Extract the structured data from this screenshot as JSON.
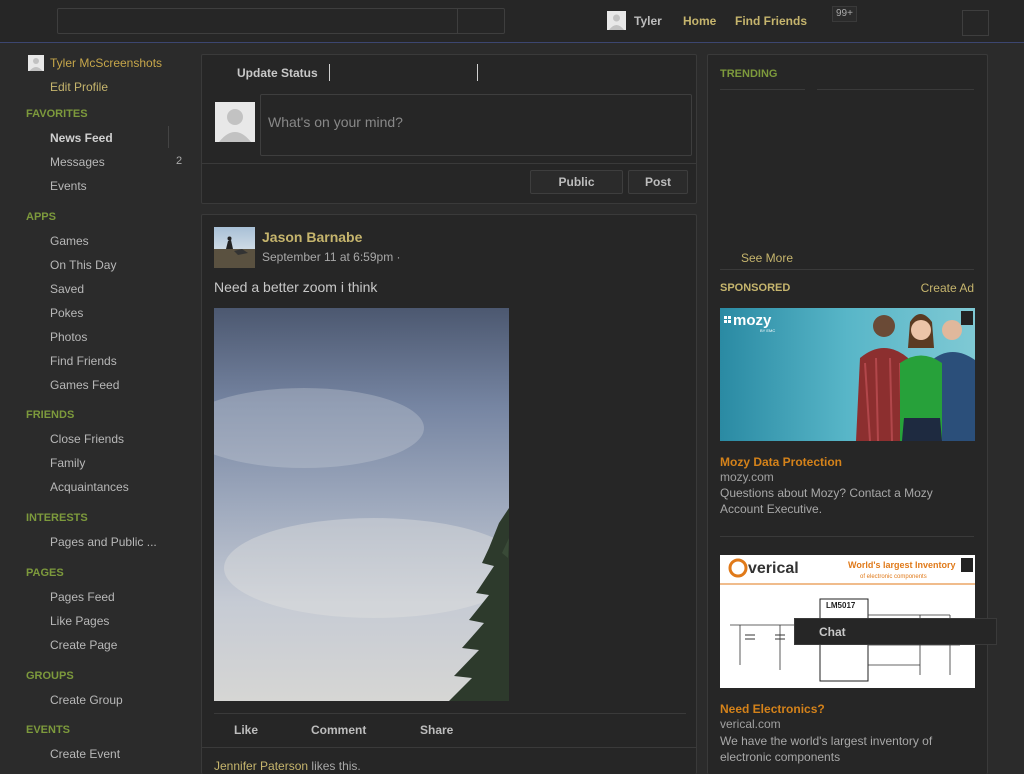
{
  "topbar": {
    "user_name": "Tyler",
    "home": "Home",
    "find_friends": "Find Friends",
    "notif_badge": "99+"
  },
  "sidebar": {
    "profile_name": "Tyler McScreenshots",
    "edit_profile": "Edit Profile",
    "favorites": {
      "heading": "FAVORITES",
      "items": [
        "News Feed",
        "Messages",
        "Events"
      ],
      "messages_count": "2"
    },
    "apps": {
      "heading": "APPS",
      "items": [
        "Games",
        "On This Day",
        "Saved",
        "Pokes",
        "Photos",
        "Find Friends",
        "Games Feed"
      ]
    },
    "friends": {
      "heading": "FRIENDS",
      "items": [
        "Close Friends",
        "Family",
        "Acquaintances"
      ]
    },
    "interests": {
      "heading": "INTERESTS",
      "items": [
        "Pages and Public ..."
      ]
    },
    "pages": {
      "heading": "PAGES",
      "items": [
        "Pages Feed",
        "Like Pages",
        "Create Page"
      ]
    },
    "groups": {
      "heading": "GROUPS",
      "items": [
        "Create Group"
      ]
    },
    "events": {
      "heading": "EVENTS",
      "items": [
        "Create Event"
      ]
    }
  },
  "composer": {
    "tab": "Update Status",
    "placeholder": "What's on your mind?",
    "audience": "Public",
    "post": "Post"
  },
  "post": {
    "author": "Jason Barnabe",
    "time": "September 11 at 6:59pm ·",
    "text": "Need a better zoom i think",
    "actions": {
      "like": "Like",
      "comment": "Comment",
      "share": "Share"
    },
    "likes_name": "Jennifer Paterson",
    "likes_suffix": " likes this."
  },
  "right": {
    "trending": "TRENDING",
    "see_more": "See More",
    "sponsored": "SPONSORED",
    "create_ad": "Create Ad",
    "ads": [
      {
        "brand": "mozy",
        "brand_sub": "BY EMC",
        "title": "Mozy Data Protection",
        "domain": "mozy.com",
        "desc": "Questions about Mozy? Contact a Mozy Account Executive."
      },
      {
        "brand": "verical",
        "tagline1": "World's largest Inventory",
        "tagline2": "of electronic components",
        "chip": "LM5017",
        "title": "Need Electronics?",
        "domain": "verical.com",
        "desc": "We have the world's largest inventory of electronic components"
      }
    ]
  },
  "chat": {
    "label": "Chat"
  }
}
